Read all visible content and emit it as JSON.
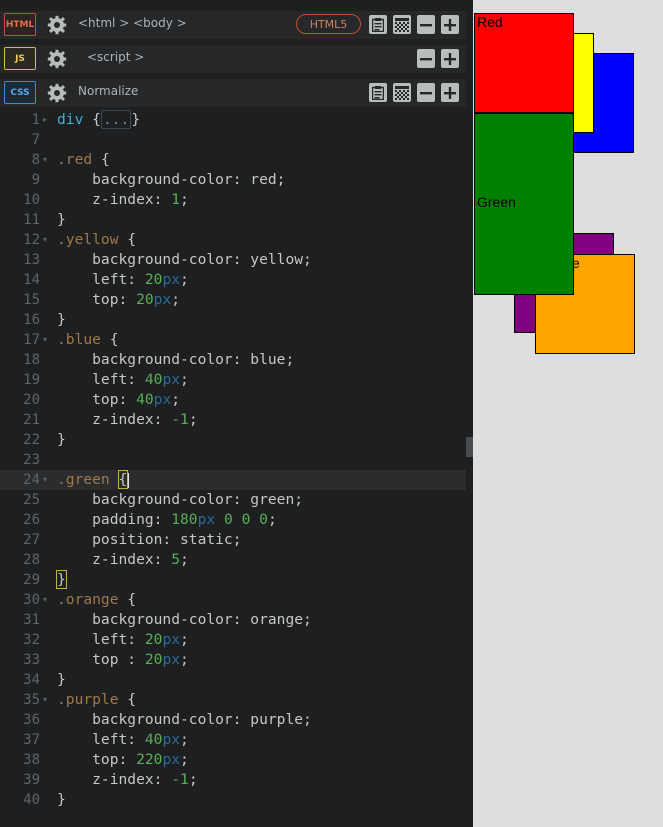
{
  "panels": {
    "html": {
      "badge": "HTML",
      "label": "<html > <body >",
      "doctype": "HTML5"
    },
    "js": {
      "badge": "JS",
      "label": "<script >"
    },
    "css": {
      "badge": "CSS",
      "label": "Normalize"
    }
  },
  "icons": [
    "gear-icon",
    "clipboard-icon",
    "checker-icon",
    "minus-icon",
    "plus-icon"
  ],
  "code_lines": [
    {
      "n": "1",
      "fold": "right",
      "parts": [
        [
          "tag",
          "div "
        ],
        [
          "txt",
          "{"
        ],
        [
          "fold",
          "..."
        ],
        [
          "txt",
          "}"
        ]
      ]
    },
    {
      "n": "7",
      "fold": "",
      "parts": []
    },
    {
      "n": "8",
      "fold": "down",
      "parts": [
        [
          "sel",
          ".red "
        ],
        [
          "txt",
          "{"
        ]
      ]
    },
    {
      "n": "9",
      "fold": "",
      "parts": [
        [
          "txt",
          "    background-color: red;"
        ]
      ]
    },
    {
      "n": "10",
      "fold": "",
      "parts": [
        [
          "txt",
          "    z-index: "
        ],
        [
          "num",
          "1"
        ],
        [
          "txt",
          ";"
        ]
      ]
    },
    {
      "n": "11",
      "fold": "",
      "parts": [
        [
          "txt",
          "}"
        ]
      ]
    },
    {
      "n": "12",
      "fold": "down",
      "parts": [
        [
          "sel",
          ".yellow "
        ],
        [
          "txt",
          "{"
        ]
      ]
    },
    {
      "n": "13",
      "fold": "",
      "parts": [
        [
          "txt",
          "    background-color: yellow;"
        ]
      ]
    },
    {
      "n": "14",
      "fold": "",
      "parts": [
        [
          "txt",
          "    left: "
        ],
        [
          "num",
          "20"
        ],
        [
          "unit",
          "px"
        ],
        [
          "txt",
          ";"
        ]
      ]
    },
    {
      "n": "15",
      "fold": "",
      "parts": [
        [
          "txt",
          "    top: "
        ],
        [
          "num",
          "20"
        ],
        [
          "unit",
          "px"
        ],
        [
          "txt",
          ";"
        ]
      ]
    },
    {
      "n": "16",
      "fold": "",
      "parts": [
        [
          "txt",
          "}"
        ]
      ]
    },
    {
      "n": "17",
      "fold": "down",
      "parts": [
        [
          "sel",
          ".blue "
        ],
        [
          "txt",
          "{"
        ]
      ]
    },
    {
      "n": "18",
      "fold": "",
      "parts": [
        [
          "txt",
          "    background-color: blue;"
        ]
      ]
    },
    {
      "n": "19",
      "fold": "",
      "parts": [
        [
          "txt",
          "    left: "
        ],
        [
          "num",
          "40"
        ],
        [
          "unit",
          "px"
        ],
        [
          "txt",
          ";"
        ]
      ]
    },
    {
      "n": "20",
      "fold": "",
      "parts": [
        [
          "txt",
          "    top: "
        ],
        [
          "num",
          "40"
        ],
        [
          "unit",
          "px"
        ],
        [
          "txt",
          ";"
        ]
      ]
    },
    {
      "n": "21",
      "fold": "",
      "parts": [
        [
          "txt",
          "    z-index: "
        ],
        [
          "num",
          "-1"
        ],
        [
          "txt",
          ";"
        ]
      ]
    },
    {
      "n": "22",
      "fold": "",
      "parts": [
        [
          "txt",
          "}"
        ]
      ]
    },
    {
      "n": "23",
      "fold": "",
      "parts": []
    },
    {
      "n": "24",
      "fold": "down",
      "active": true,
      "parts": [
        [
          "sel",
          ".green "
        ],
        [
          "hl",
          "{"
        ],
        [
          "cursor",
          ""
        ]
      ]
    },
    {
      "n": "25",
      "fold": "",
      "parts": [
        [
          "txt",
          "    background-color: green;"
        ]
      ]
    },
    {
      "n": "26",
      "fold": "",
      "parts": [
        [
          "txt",
          "    padding: "
        ],
        [
          "num",
          "180"
        ],
        [
          "unit",
          "px"
        ],
        [
          "txt",
          " "
        ],
        [
          "num",
          "0"
        ],
        [
          "txt",
          " "
        ],
        [
          "num",
          "0"
        ],
        [
          "txt",
          " "
        ],
        [
          "num",
          "0"
        ],
        [
          "txt",
          ";"
        ]
      ]
    },
    {
      "n": "27",
      "fold": "",
      "parts": [
        [
          "txt",
          "    position: static;"
        ]
      ]
    },
    {
      "n": "28",
      "fold": "",
      "parts": [
        [
          "txt",
          "    z-index: "
        ],
        [
          "num",
          "5"
        ],
        [
          "txt",
          ";"
        ]
      ]
    },
    {
      "n": "29",
      "fold": "",
      "parts": [
        [
          "hl",
          "}"
        ]
      ]
    },
    {
      "n": "30",
      "fold": "down",
      "parts": [
        [
          "sel",
          ".orange "
        ],
        [
          "txt",
          "{"
        ]
      ]
    },
    {
      "n": "31",
      "fold": "",
      "parts": [
        [
          "txt",
          "    background-color: orange;"
        ]
      ]
    },
    {
      "n": "32",
      "fold": "",
      "parts": [
        [
          "txt",
          "    left: "
        ],
        [
          "num",
          "20"
        ],
        [
          "unit",
          "px"
        ],
        [
          "txt",
          ";"
        ]
      ]
    },
    {
      "n": "33",
      "fold": "",
      "parts": [
        [
          "txt",
          "    top : "
        ],
        [
          "num",
          "20"
        ],
        [
          "unit",
          "px"
        ],
        [
          "txt",
          ";"
        ]
      ]
    },
    {
      "n": "34",
      "fold": "",
      "parts": [
        [
          "txt",
          "}"
        ]
      ]
    },
    {
      "n": "35",
      "fold": "down",
      "parts": [
        [
          "sel",
          ".purple "
        ],
        [
          "txt",
          "{"
        ]
      ]
    },
    {
      "n": "36",
      "fold": "",
      "parts": [
        [
          "txt",
          "    background-color: purple;"
        ]
      ]
    },
    {
      "n": "37",
      "fold": "",
      "parts": [
        [
          "txt",
          "    left: "
        ],
        [
          "num",
          "40"
        ],
        [
          "unit",
          "px"
        ],
        [
          "txt",
          ";"
        ]
      ]
    },
    {
      "n": "38",
      "fold": "",
      "parts": [
        [
          "txt",
          "    top: "
        ],
        [
          "num",
          "220"
        ],
        [
          "unit",
          "px"
        ],
        [
          "txt",
          ";"
        ]
      ]
    },
    {
      "n": "39",
      "fold": "",
      "parts": [
        [
          "txt",
          "    z-index: "
        ],
        [
          "num",
          "-1"
        ],
        [
          "txt",
          ";"
        ]
      ]
    },
    {
      "n": "40",
      "fold": "",
      "parts": [
        [
          "txt",
          "}"
        ]
      ]
    }
  ],
  "preview": {
    "red_label": "Red",
    "green_label": "Green",
    "orange_label": "e",
    "colors": {
      "red": "#ff0000",
      "yellow": "#ffff00",
      "blue": "#0000ff",
      "green": "#008000",
      "orange": "#ffa500",
      "purple": "#800080",
      "background": "#dedede"
    }
  }
}
